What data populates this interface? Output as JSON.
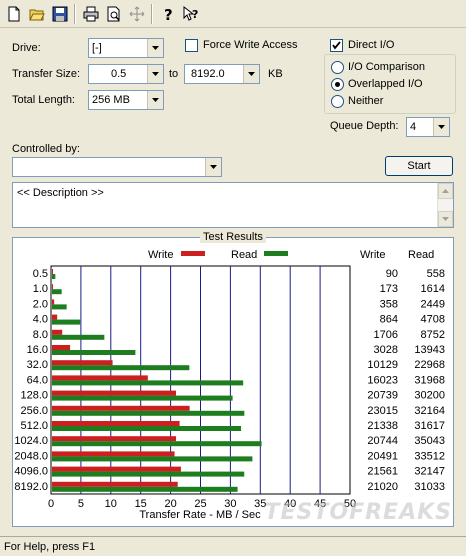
{
  "toolbar": {
    "icons": [
      "new-document-icon",
      "open-folder-icon",
      "save-icon",
      "print-icon",
      "print-preview-icon",
      "move-icon",
      "help-icon",
      "context-help-icon"
    ]
  },
  "form": {
    "drive_label": "Drive:",
    "drive_value": "[-]",
    "transfer_size_label": "Transfer Size:",
    "transfer_size_from": "0.5",
    "to_label": "to",
    "transfer_size_to": "8192.0",
    "kb_label": "KB",
    "total_length_label": "Total Length:",
    "total_length_value": "256 MB",
    "force_write_access_label": "Force Write Access",
    "force_write_access_checked": false,
    "direct_io_label": "Direct I/O",
    "direct_io_checked": true,
    "io_comparison_label": "I/O Comparison",
    "overlapped_io_label": "Overlapped I/O",
    "neither_label": "Neither",
    "selected_mode": "Overlapped I/O",
    "queue_depth_label": "Queue Depth:",
    "queue_depth_value": "4",
    "controlled_by_label": "Controlled by:",
    "controlled_by_value": "",
    "start_label": "Start",
    "description_text": "<< Description >>"
  },
  "results": {
    "title": "Test Results",
    "write_col": "Write",
    "read_col": "Read",
    "legend_write": "Write",
    "legend_read": "Read",
    "write_color": "#cc2020",
    "read_color": "#1e7d1e",
    "rows": [
      {
        "size": "0.5",
        "write": "90",
        "read": "558"
      },
      {
        "size": "1.0",
        "write": "173",
        "read": "1614"
      },
      {
        "size": "2.0",
        "write": "358",
        "read": "2449"
      },
      {
        "size": "4.0",
        "write": "864",
        "read": "4708"
      },
      {
        "size": "8.0",
        "write": "1706",
        "read": "8752"
      },
      {
        "size": "16.0",
        "write": "3028",
        "read": "13943"
      },
      {
        "size": "32.0",
        "write": "10129",
        "read": "22968"
      },
      {
        "size": "64.0",
        "write": "16023",
        "read": "31968"
      },
      {
        "size": "128.0",
        "write": "20739",
        "read": "30200"
      },
      {
        "size": "256.0",
        "write": "23015",
        "read": "32164"
      },
      {
        "size": "512.0",
        "write": "21338",
        "read": "31617"
      },
      {
        "size": "1024.0",
        "write": "20744",
        "read": "35043"
      },
      {
        "size": "2048.0",
        "write": "20491",
        "read": "33512"
      },
      {
        "size": "4096.0",
        "write": "21561",
        "read": "32147"
      },
      {
        "size": "8192.0",
        "write": "21020",
        "read": "31033"
      }
    ],
    "x_axis_label": "Transfer Rate - MB / Sec",
    "x_ticks": [
      "0",
      "5",
      "10",
      "15",
      "20",
      "25",
      "30",
      "35",
      "40",
      "45",
      "50"
    ]
  },
  "chart_data": {
    "type": "bar",
    "title": "Test Results",
    "xlabel": "Transfer Rate - MB / Sec",
    "ylabel": "",
    "xlim": [
      0,
      50
    ],
    "categories": [
      "0.5",
      "1.0",
      "2.0",
      "4.0",
      "8.0",
      "16.0",
      "32.0",
      "64.0",
      "128.0",
      "256.0",
      "512.0",
      "1024.0",
      "2048.0",
      "4096.0",
      "8192.0"
    ],
    "series": [
      {
        "name": "Write",
        "values": [
          0.09,
          0.173,
          0.358,
          0.864,
          1.706,
          3.028,
          10.129,
          16.023,
          20.739,
          23.015,
          21.338,
          20.744,
          20.491,
          21.561,
          21.02
        ]
      },
      {
        "name": "Read",
        "values": [
          0.558,
          1.614,
          2.449,
          4.708,
          8.752,
          13.943,
          22.968,
          31.968,
          30.2,
          32.164,
          31.617,
          35.043,
          33.512,
          32.147,
          31.033
        ]
      }
    ]
  },
  "status_bar": {
    "text": "For Help, press F1"
  },
  "watermark": "TESTOFREAKS"
}
